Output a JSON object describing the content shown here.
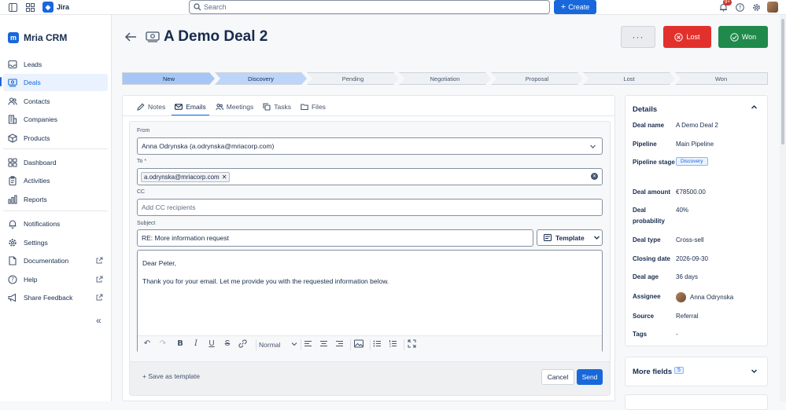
{
  "topbar": {
    "app_name": "Jira",
    "search_placeholder": "Search",
    "create_label": "Create",
    "notification_count": "9+"
  },
  "sidebar": {
    "brand": "Mria CRM",
    "items": [
      {
        "label": "Leads",
        "icon": "inbox-icon"
      },
      {
        "label": "Deals",
        "icon": "deal-icon",
        "active": true
      },
      {
        "label": "Contacts",
        "icon": "contacts-icon"
      },
      {
        "label": "Companies",
        "icon": "building-icon"
      },
      {
        "label": "Products",
        "icon": "box-icon"
      },
      {
        "label": "Dashboard",
        "icon": "dashboard-icon"
      },
      {
        "label": "Activities",
        "icon": "clipboard-icon"
      },
      {
        "label": "Reports",
        "icon": "bar-chart-icon"
      },
      {
        "label": "Notifications",
        "icon": "bell-icon"
      },
      {
        "label": "Settings",
        "icon": "gear-icon"
      },
      {
        "label": "Documentation",
        "icon": "document-icon",
        "external": true
      },
      {
        "label": "Help",
        "icon": "help-icon",
        "external": true
      },
      {
        "label": "Share Feedback",
        "icon": "megaphone-icon",
        "external": true
      }
    ]
  },
  "deal": {
    "title": "A Demo Deal 2",
    "more_label": "···",
    "lost_label": "Lost",
    "won_label": "Won"
  },
  "pipeline": {
    "stages": [
      "New",
      "Discovery",
      "Pending",
      "Negotiation",
      "Proposal",
      "Lost",
      "Won"
    ],
    "current": "Discovery"
  },
  "tabs": [
    {
      "label": "Notes",
      "icon": "pencil-icon"
    },
    {
      "label": "Emails",
      "icon": "mail-icon",
      "active": true
    },
    {
      "label": "Meetings",
      "icon": "people-icon"
    },
    {
      "label": "Tasks",
      "icon": "copy-icon"
    },
    {
      "label": "Files",
      "icon": "folder-icon"
    }
  ],
  "email": {
    "from_label": "From",
    "from_value": "Anna Odrynska (a.odrynska@mriacorp.com)",
    "to_label": "To",
    "to_required": "*",
    "to_chip": "a.odrynska@mriacorp.com",
    "cc_label": "CC",
    "cc_placeholder": "Add CC recipients",
    "subject_label": "Subject",
    "subject_value": "RE: More information request",
    "template_label": "Template",
    "body_line1": "Dear Peter,",
    "body_line2": "Thank you for your email. Let me provide you with the requested information below.",
    "format_label": "Normal",
    "save_template_label": "+ Save as template",
    "cancel_label": "Cancel",
    "send_label": "Send"
  },
  "details": {
    "title": "Details",
    "rows": [
      {
        "key": "Deal name",
        "value": "A Demo Deal 2"
      },
      {
        "key": "Pipeline",
        "value": "Main Pipeline"
      },
      {
        "key": "Pipeline stage",
        "value": "Discovery"
      },
      {
        "key": "Deal amount",
        "value": "€78500.00"
      },
      {
        "key": "Deal probability",
        "value": "40%"
      },
      {
        "key": "Deal type",
        "value": "Cross-sell"
      },
      {
        "key": "Closing date",
        "value": "2026-09-30"
      },
      {
        "key": "Deal age",
        "value": "36 days"
      },
      {
        "key": "Assignee",
        "value": "Anna Odrynska"
      },
      {
        "key": "Source",
        "value": "Referral"
      },
      {
        "key": "Tags",
        "value": "-"
      }
    ]
  },
  "more_fields": {
    "title": "More fields",
    "count": "5"
  },
  "colors": {
    "primary": "#1868db",
    "lost": "#e2312c",
    "won": "#1f8a4c"
  }
}
